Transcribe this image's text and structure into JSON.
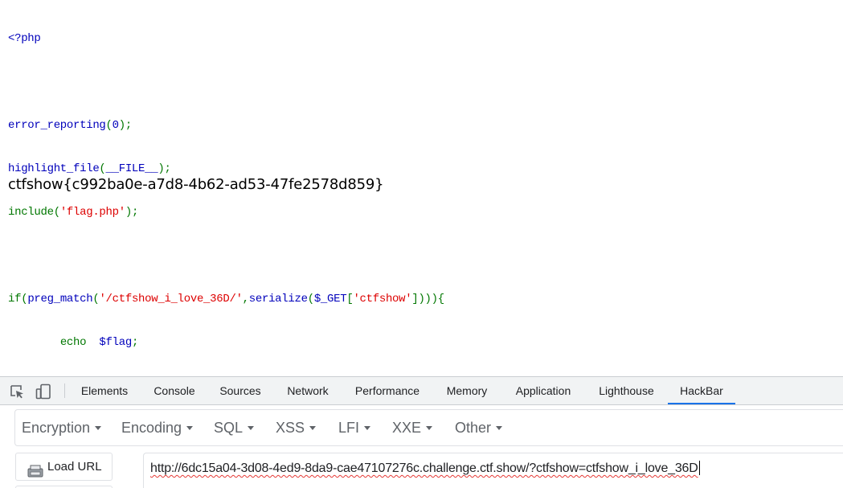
{
  "source": {
    "line1": "<?php",
    "line3": {
      "fn": "error_reporting",
      "open": "(",
      "arg": "0",
      "close": ");"
    },
    "line4": {
      "fn": "highlight_file",
      "open": "(",
      "arg": "__FILE__",
      "close": ");"
    },
    "line5": {
      "kw": "include",
      "open": "(",
      "arg": "'flag.php'",
      "close": ");"
    },
    "line7": {
      "kw": "if(",
      "fn": "preg_match",
      "open": "(",
      "pattern": "'/ctfshow_i_love_36D/'",
      "comma": ",",
      "fn2": "serialize",
      "open2": "(",
      "var": "$_GET",
      "bracket": "[",
      "key": "'ctfshow'",
      "close": "]))){"
    },
    "line8": {
      "kw": "echo",
      "var": "$flag",
      "close": ";"
    },
    "line9": "}"
  },
  "output": {
    "flag": "ctfshow{c992ba0e-a7d8-4b62-ad53-47fe2578d859}"
  },
  "devtools": {
    "tabs": [
      "Elements",
      "Console",
      "Sources",
      "Network",
      "Performance",
      "Memory",
      "Application",
      "Lighthouse",
      "HackBar"
    ],
    "active_tab": "HackBar",
    "icons": [
      "inspect-element-icon",
      "device-toolbar-icon"
    ]
  },
  "hackbar": {
    "menus": [
      "Encryption",
      "Encoding",
      "SQL",
      "XSS",
      "LFI",
      "XXE",
      "Other"
    ],
    "load_url_label": "Load URL",
    "url_value": "http://6dc15a04-3d08-4ed9-8da9-cae47107276c.challenge.ctf.show/?ctfshow=ctfshow_i_love_36D"
  },
  "colors": {
    "php_default": "#0000bb",
    "php_keyword": "#007700",
    "php_string": "#dd0000",
    "active_tab_underline": "#1a73e8"
  }
}
